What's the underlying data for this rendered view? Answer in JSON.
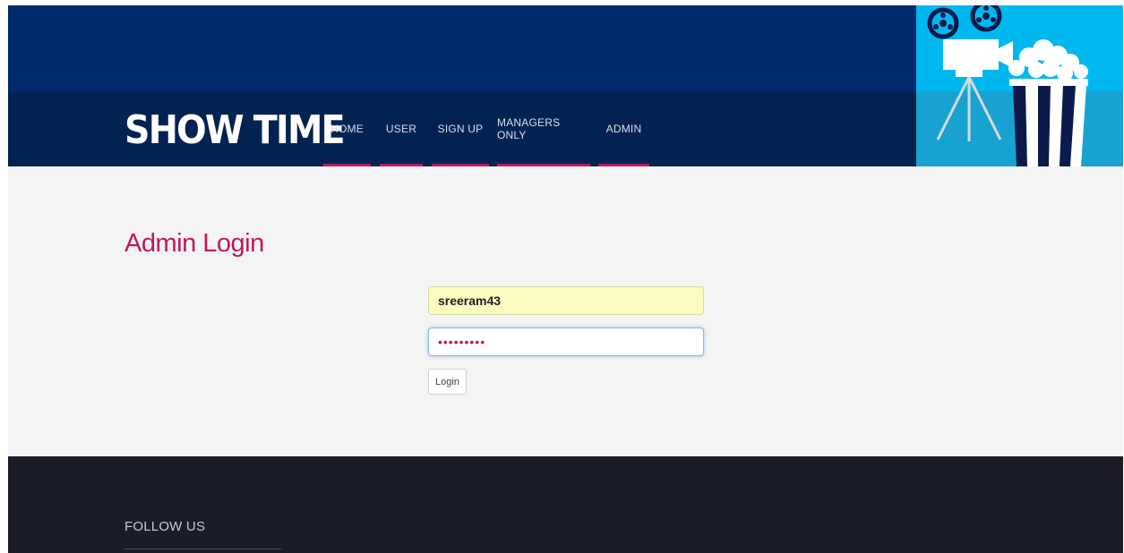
{
  "header": {
    "brand": "SHOW TIME",
    "nav": [
      {
        "label": "HOME"
      },
      {
        "label": "USER"
      },
      {
        "label": "SIGN UP"
      },
      {
        "label": "MANAGERS ONLY"
      },
      {
        "label": "ADMIN"
      }
    ],
    "hero_image": {
      "icons": [
        "film-camera-icon",
        "popcorn-icon"
      ],
      "background_color": "#00b8ef"
    }
  },
  "main": {
    "title": "Admin Login",
    "form": {
      "username_value": "sreeram43",
      "password_value": "sreeram43",
      "login_label": "Login"
    }
  },
  "footer": {
    "follow_label": "FOLLOW US"
  },
  "colors": {
    "header_top": "#002a6c",
    "header_nav": "#022352",
    "accent": "#c2185b",
    "footer": "#1a1c27",
    "autofill": "#fbfbc0"
  }
}
